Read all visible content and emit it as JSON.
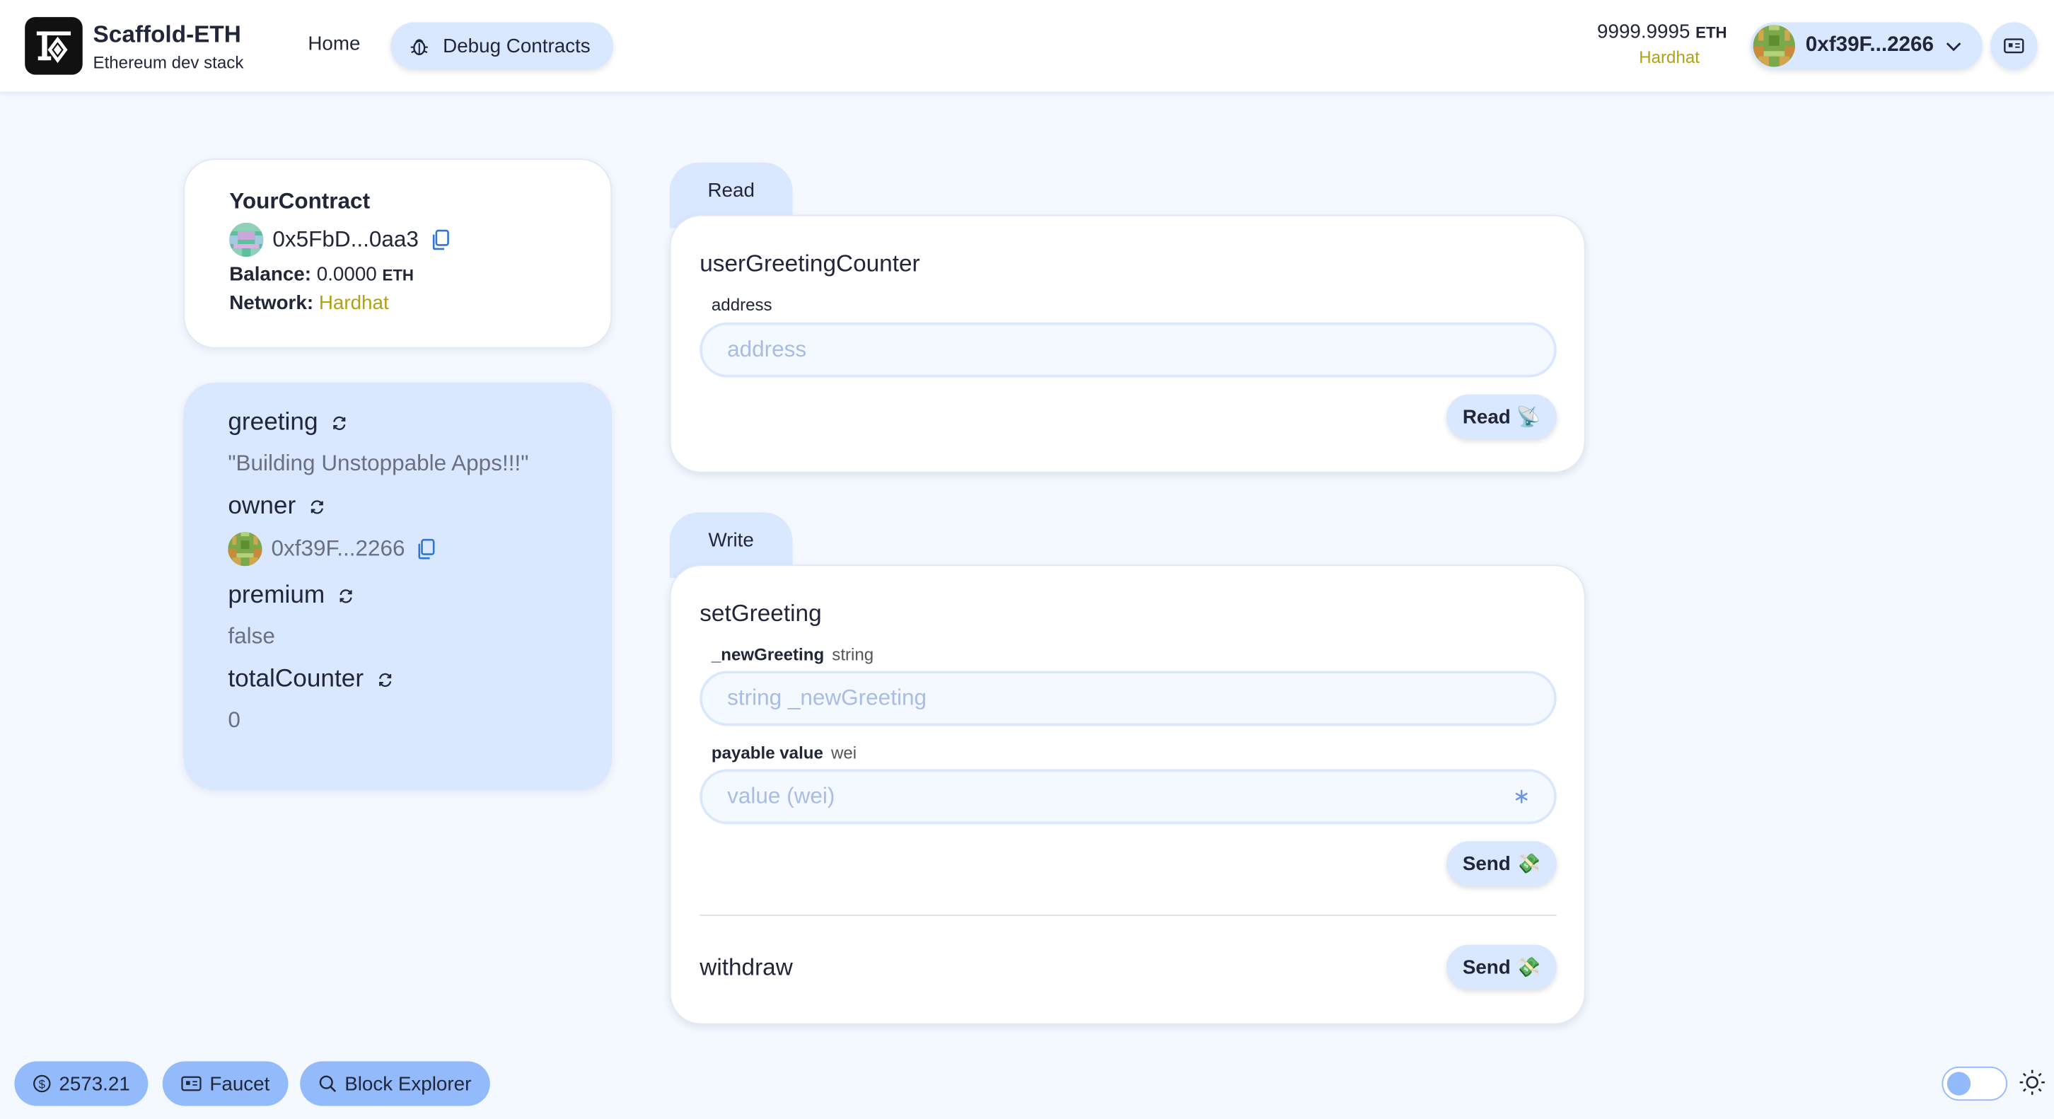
{
  "header": {
    "brand_title": "Scaffold-ETH",
    "brand_subtitle": "Ethereum dev stack",
    "nav_home": "Home",
    "nav_debug": "Debug Contracts",
    "balance_value": "9999.9995",
    "balance_unit": "ETH",
    "network": "Hardhat",
    "account": "0xf39F...2266"
  },
  "contract": {
    "name": "YourContract",
    "address": "0x5FbD...0aa3",
    "balance_label": "Balance:",
    "balance_value": "0.0000",
    "balance_unit": "ETH",
    "network_label": "Network:",
    "network_value": "Hardhat"
  },
  "vars": {
    "greeting_name": "greeting",
    "greeting_value": "\"Building Unstoppable Apps!!!\"",
    "owner_name": "owner",
    "owner_value": "0xf39F...2266",
    "premium_name": "premium",
    "premium_value": "false",
    "total_name": "totalCounter",
    "total_value": "0"
  },
  "read": {
    "tab": "Read",
    "fn_name": "userGreetingCounter",
    "param_label": "address",
    "placeholder": "address",
    "button": "Read 📡"
  },
  "write": {
    "tab": "Write",
    "fn_name": "setGreeting",
    "param_name": "_newGreeting",
    "param_type": "string",
    "placeholder": "string _newGreeting",
    "payable_label": "payable value",
    "payable_type": "wei",
    "payable_placeholder": "value (wei)",
    "payable_suffix": "∗",
    "send_button": "Send 💸",
    "withdraw_name": "withdraw",
    "withdraw_button": "Send 💸"
  },
  "footer": {
    "price": "2573.21",
    "faucet": "Faucet",
    "explorer": "Block Explorer"
  },
  "colors": {
    "accent": "#93bbfb",
    "secondary": "#dae8ff",
    "network": "#b2a112"
  }
}
